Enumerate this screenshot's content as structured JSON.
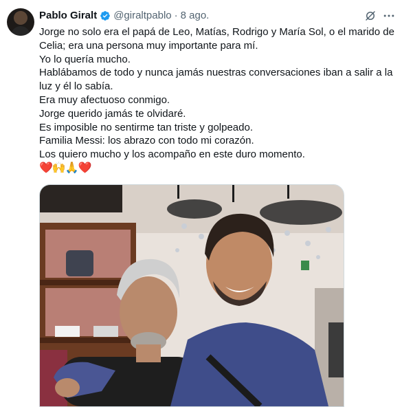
{
  "tweet": {
    "author": {
      "display_name": "Pablo Giralt",
      "handle": "@giraltpablo",
      "separator": "·",
      "date": "8 ago."
    },
    "lines": [
      "Jorge no solo era el papá de Leo, Matías, Rodrigo y María Sol, o el marido de Celia; era una persona muy importante para mí.",
      "Yo lo quería mucho.",
      "Hablábamos de todo y nunca jamás nuestras conversaciones iban a salir a la luz y él lo sabía.",
      "Era muy afectuoso conmigo.",
      "Jorge querido jamás te olvidaré.",
      "Es imposible no sentirme tan triste y golpeado.",
      "Familia Messi: los abrazo con todo mi corazón.",
      "Los quiero mucho y los acompaño en este duro momento."
    ],
    "emojis": "❤️🙌🙏❤️"
  },
  "icons": {
    "verified": "verified-badge-icon",
    "grok": "grok-icon",
    "more": "more-options-icon"
  },
  "colors": {
    "verified_blue": "#1d9bf0",
    "secondary_text": "#536471",
    "primary_text": "#0f1419",
    "border": "#cfd9de"
  }
}
